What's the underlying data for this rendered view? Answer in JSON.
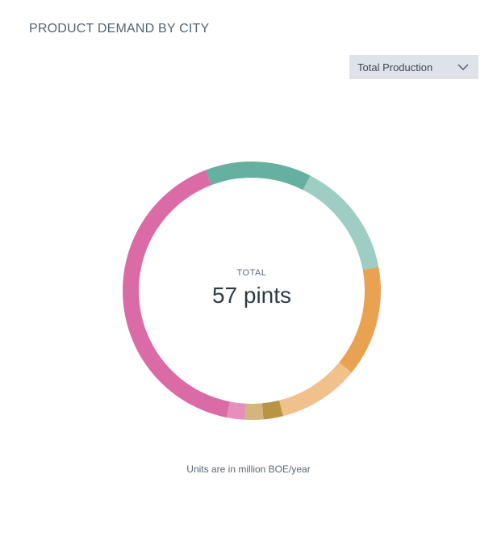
{
  "header": {
    "title": "PRODUCT DEMAND BY CITY"
  },
  "dropdown": {
    "selected": "Total Production",
    "icon": "chevron-down-icon"
  },
  "center": {
    "label": "TOTAL",
    "value": "57 pints"
  },
  "footnote": "Units are in million BOE/year",
  "chart_data": {
    "type": "pie",
    "total": 57,
    "unit": "pints",
    "slices": [
      {
        "value": 7.6,
        "color": "#66b0a0"
      },
      {
        "value": 8.3,
        "color": "#9ecdc3"
      },
      {
        "value": 7.9,
        "color": "#e9a252"
      },
      {
        "value": 5.8,
        "color": "#f0c18b"
      },
      {
        "value": 1.4,
        "color": "#b89545"
      },
      {
        "value": 1.3,
        "color": "#d4b67d"
      },
      {
        "value": 1.3,
        "color": "#e58fbc"
      },
      {
        "value": 23.4,
        "color": "#db6ba7"
      }
    ]
  }
}
